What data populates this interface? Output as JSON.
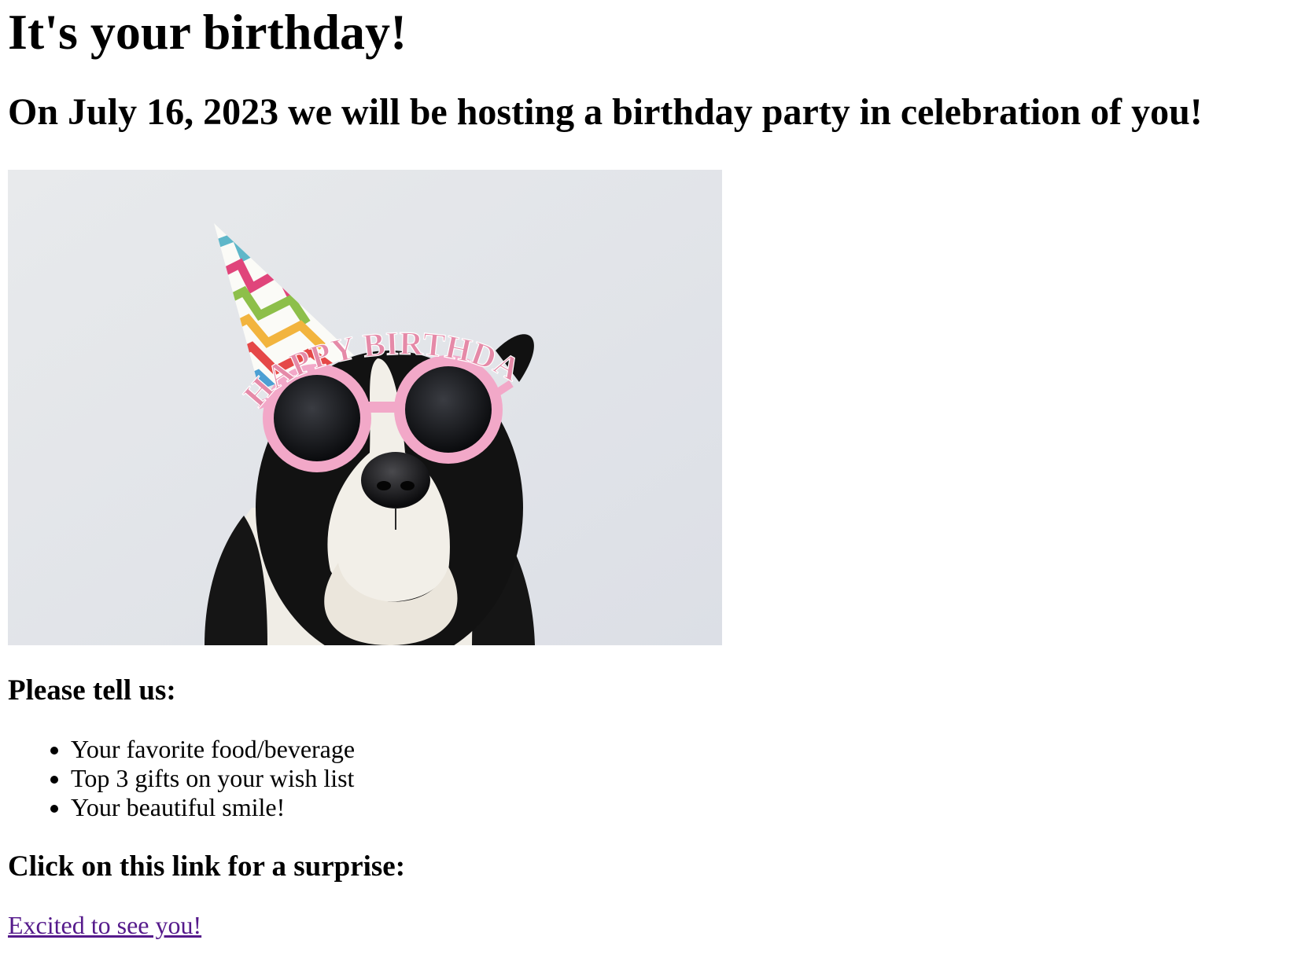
{
  "page": {
    "title": "It's your birthday!",
    "subtitle": "On July 16, 2023 we will be hosting a birthday party in celebration of you!",
    "image": {
      "subject": "dog-party-photo",
      "glasses_text": "HAPPY BIRTHDAY"
    },
    "tell_heading": "Please tell us:",
    "list_items": [
      "Your favorite food/beverage",
      "Top 3 gifts on your wish list",
      "Your beautiful smile!"
    ],
    "surprise_heading": "Click on this link for a surprise:",
    "surprise_link": "Excited to see you!"
  },
  "colors": {
    "visited_link": "#551a8b",
    "text": "#000000",
    "background": "#ffffff",
    "photo_bg": "#e4e6ea"
  }
}
